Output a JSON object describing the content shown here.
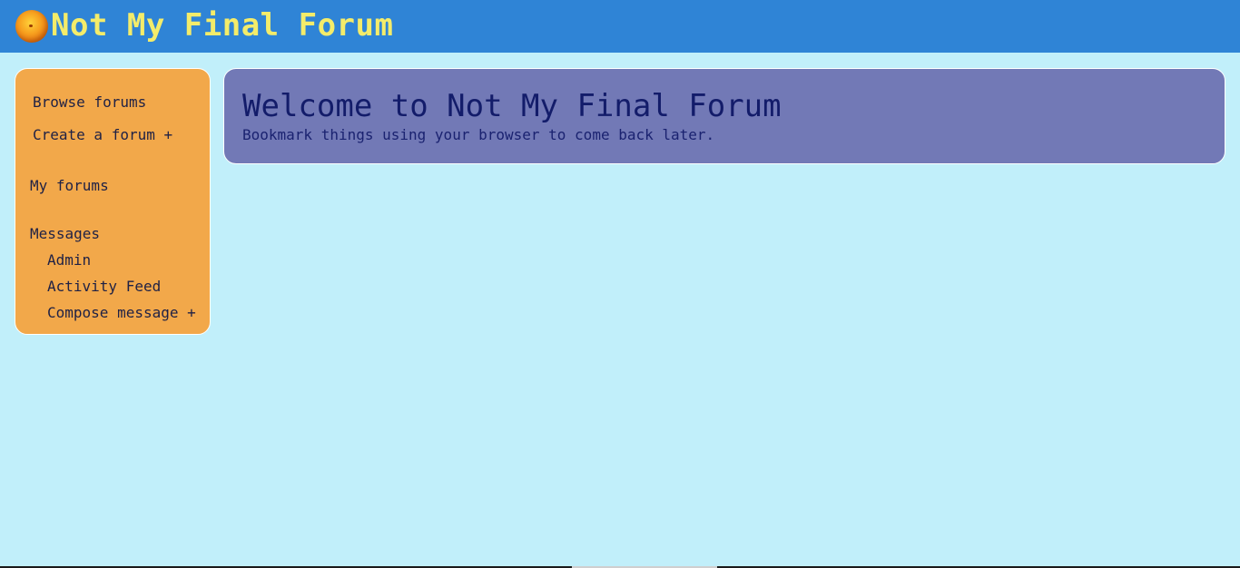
{
  "header": {
    "logo_icon": "orange-ball-icon",
    "title": "Not My Final Forum"
  },
  "sidebar": {
    "items": [
      {
        "label": "Browse forums"
      },
      {
        "label": "Create a forum +"
      },
      {
        "label": "My forums"
      },
      {
        "label": "Messages"
      },
      {
        "label": "Admin"
      },
      {
        "label": "Activity Feed"
      },
      {
        "label": "Compose message +"
      }
    ]
  },
  "main": {
    "welcome_title": "Welcome to Not My Final Forum",
    "welcome_subtitle": "Bookmark things using your browser to come back later."
  },
  "colors": {
    "page_background": "#c1effa",
    "header_background": "#2f84d6",
    "header_text": "#f4ec6a",
    "sidebar_background": "#f2a84a",
    "welcome_background": "#7279b6",
    "welcome_text": "#131c6a"
  }
}
